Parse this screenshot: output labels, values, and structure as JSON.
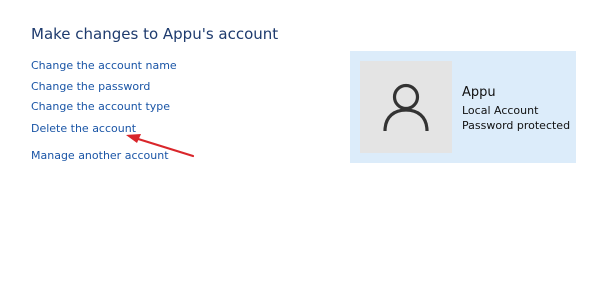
{
  "heading": "Make changes to Appu's account",
  "links": {
    "change_name": "Change the account name",
    "change_password": "Change the password",
    "change_type": "Change the account type",
    "delete_account": "Delete the account",
    "manage_another": "Manage another account"
  },
  "account": {
    "name": "Appu",
    "type": "Local Account",
    "status": "Password protected",
    "avatar_icon": "user-silhouette-icon"
  },
  "annotation": {
    "arrow_icon": "red-arrow-icon",
    "arrow_color": "#d9262b"
  },
  "colors": {
    "link": "#1a55a6",
    "heading": "#1e3b6e",
    "card_background": "#dcecfa",
    "avatar_background": "#e4e4e4"
  }
}
